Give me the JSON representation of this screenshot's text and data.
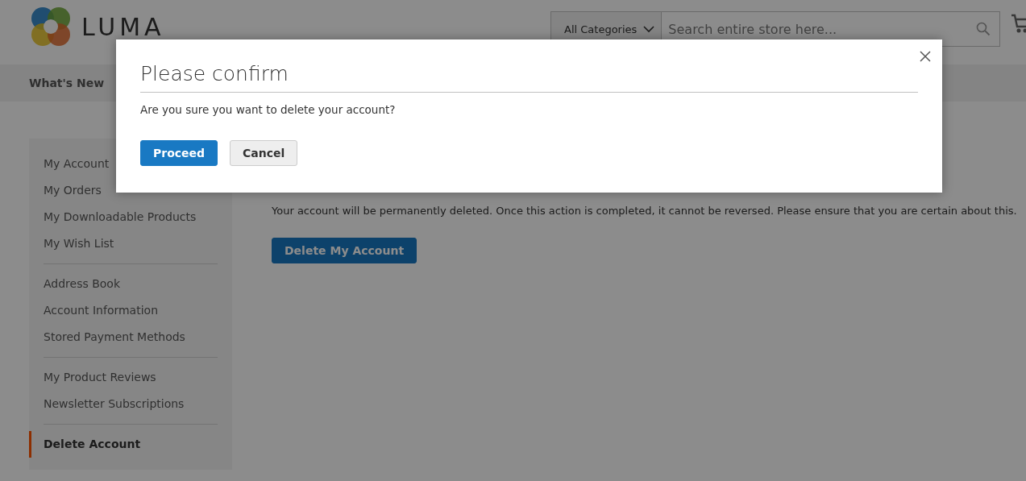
{
  "header": {
    "logo_text": "LUMA",
    "category_select": "All Categories",
    "search": {
      "placeholder": "Search entire store here..."
    }
  },
  "nav": {
    "items": [
      {
        "label": "What's New"
      }
    ]
  },
  "sidebar": {
    "groups": [
      {
        "items": [
          {
            "label": "My Account",
            "selected": false
          },
          {
            "label": "My Orders",
            "selected": false
          },
          {
            "label": "My Downloadable Products",
            "selected": false
          },
          {
            "label": "My Wish List",
            "selected": false
          }
        ]
      },
      {
        "items": [
          {
            "label": "Address Book",
            "selected": false
          },
          {
            "label": "Account Information",
            "selected": false
          },
          {
            "label": "Stored Payment Methods",
            "selected": false
          }
        ]
      },
      {
        "items": [
          {
            "label": "My Product Reviews",
            "selected": false
          },
          {
            "label": "Newsletter Subscriptions",
            "selected": false
          }
        ]
      },
      {
        "items": [
          {
            "label": "Delete Account",
            "selected": true
          }
        ]
      }
    ]
  },
  "main": {
    "message": "Your account will be permanently deleted. Once this action is completed, it cannot be reversed. Please ensure that you are certain about this.",
    "button": "Delete My Account"
  },
  "modal": {
    "title": "Please confirm",
    "text": "Are you sure you want to delete your account?",
    "buttons": [
      {
        "label": "Proceed",
        "kind": "primary"
      },
      {
        "label": "Cancel",
        "kind": "secondary"
      }
    ]
  }
}
